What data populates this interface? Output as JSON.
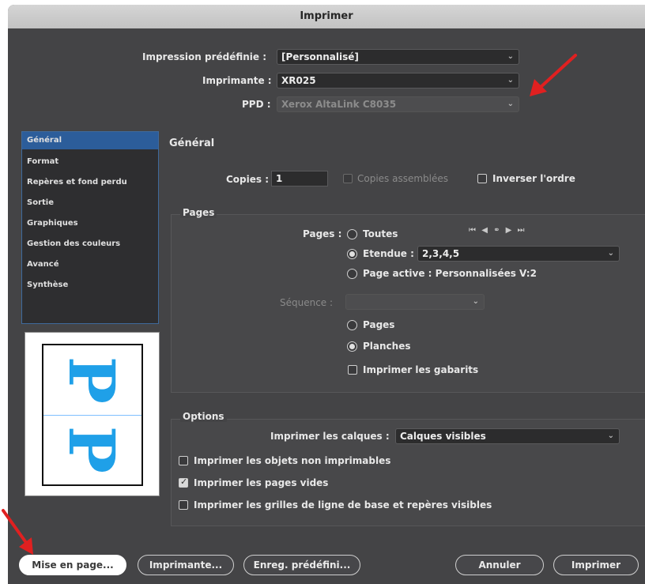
{
  "window": {
    "title": "Imprimer"
  },
  "top": {
    "preset_label": "Impression prédéfinie :",
    "preset_value": "[Personnalisé]",
    "printer_label": "Imprimante :",
    "printer_value": "XR025",
    "ppd_label": "PPD :",
    "ppd_value": "Xerox AltaLink C8035"
  },
  "sidebar": {
    "items": [
      {
        "label": "Général"
      },
      {
        "label": "Format"
      },
      {
        "label": "Repères et fond perdu"
      },
      {
        "label": "Sortie"
      },
      {
        "label": "Graphiques"
      },
      {
        "label": "Gestion des couleurs"
      },
      {
        "label": "Avancé"
      },
      {
        "label": "Synthèse"
      }
    ]
  },
  "preview": {
    "glyph": "P"
  },
  "general": {
    "heading": "Général",
    "copies_label": "Copies :",
    "copies_value": "1",
    "collate_label": "Copies assemblées",
    "reverse_label": "Inverser l'ordre"
  },
  "pages": {
    "heading": "Pages",
    "pages_label": "Pages :",
    "all_label": "Toutes",
    "range_label": "Etendue :",
    "range_value": "2,3,4,5",
    "active_label": "Page active : Personnalisées V:2",
    "sequence_label": "Séquence :",
    "pages_option": "Pages",
    "spreads_option": "Planches",
    "masters_label": "Imprimer les gabarits",
    "nav_icons": [
      "first-page-icon",
      "prev-page-icon",
      "page-link-icon",
      "next-page-icon",
      "last-page-icon"
    ]
  },
  "options": {
    "heading": "Options",
    "layers_label": "Imprimer les calques :",
    "layers_value": "Calques visibles",
    "nonprinting_label": "Imprimer les objets non imprimables",
    "blank_label": "Imprimer les pages vides",
    "grids_label": "Imprimer les grilles de ligne de base et repères visibles"
  },
  "buttons": {
    "page_setup": "Mise en page...",
    "printer": "Imprimante...",
    "save_preset": "Enreg. prédéfini...",
    "cancel": "Annuler",
    "print": "Imprimer"
  },
  "colors": {
    "dialog_bg": "#444446",
    "selection": "#2c5d9a",
    "accent_arrow": "#e02020",
    "preview_glyph": "#1fa0e8"
  }
}
